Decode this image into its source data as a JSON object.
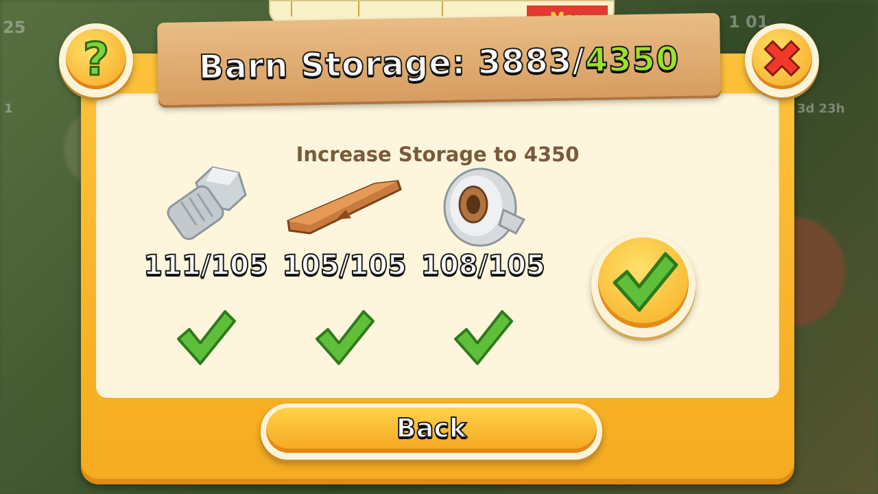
{
  "background": {
    "left_level": "25",
    "left_badge": "1",
    "right_coins": "1 01",
    "right_timer": "3d 23h"
  },
  "gauge": {
    "max_label": "Max"
  },
  "header": {
    "title_prefix": "Barn Storage: 3883/",
    "title_max": "4350"
  },
  "subtitle": "Increase Storage to 4350",
  "items": [
    {
      "name": "Bolt",
      "count": "111/105",
      "icon": "bolt-icon"
    },
    {
      "name": "Plank",
      "count": "105/105",
      "icon": "plank-icon"
    },
    {
      "name": "Duct Tape",
      "count": "108/105",
      "icon": "duct-tape-icon"
    }
  ],
  "buttons": {
    "help_icon": "question-mark-icon",
    "close_icon": "close-icon",
    "confirm_icon": "checkmark-icon",
    "back_label": "Back"
  },
  "colors": {
    "frame": "#f5ab1f",
    "panel": "#fdf6dc",
    "max_value": "#9be22c",
    "check": "#5fbf3a"
  }
}
